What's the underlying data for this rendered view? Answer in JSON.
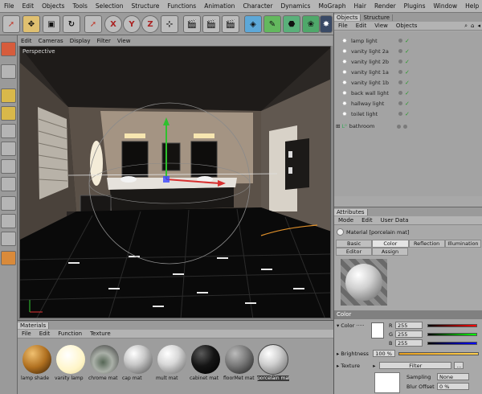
{
  "menubar": [
    "File",
    "Edit",
    "Objects",
    "Tools",
    "Selection",
    "Structure",
    "Functions",
    "Animation",
    "Character",
    "Dynamics",
    "MoGraph",
    "Hair",
    "Render",
    "Plugins",
    "Window",
    "Help"
  ],
  "toolbar": {
    "axis_x": "X",
    "axis_y": "Y",
    "axis_z": "Z"
  },
  "viewport": {
    "menu": [
      "Edit",
      "Cameras",
      "Display",
      "Filter",
      "View"
    ],
    "label": "Perspective"
  },
  "objects": {
    "tabs": [
      "Objects",
      "Structure"
    ],
    "menu": [
      "File",
      "Edit",
      "View",
      "Objects"
    ],
    "items": [
      "lamp light",
      "vanity light 2a",
      "vanity light 2b",
      "vanity light 1a",
      "vanity light 1b",
      "back wall light",
      "hallway light",
      "toilet light",
      "bathroom"
    ]
  },
  "attributes": {
    "header": "Attributes",
    "menu": [
      "Mode",
      "Edit",
      "User Data"
    ],
    "material_title": "Material [porcelain mat]",
    "tabs_row1": [
      "Basic",
      "Color",
      "Reflection",
      "Illumination"
    ],
    "tabs_row2": [
      "Editor",
      "Assign"
    ],
    "section": "Color",
    "color_label": "Color",
    "r_label": "R",
    "r_value": "255",
    "g_label": "G",
    "g_value": "255",
    "b_label": "B",
    "b_value": "255",
    "brightness_label": "Brightness",
    "brightness_value": "100 %",
    "texture_label": "Texture",
    "filter_label": "Filter",
    "sampling_label": "Sampling",
    "sampling_value": "None",
    "blur_label": "Blur Offset",
    "blur_value": "0 %"
  },
  "materials": {
    "header": "Materials",
    "menu": [
      "File",
      "Edit",
      "Function",
      "Texture"
    ],
    "items": [
      "lamp shade",
      "vanity lamp",
      "chrome mat",
      "cap mat",
      "mult mat",
      "cabinet mat",
      "floorMet mat",
      "porcelain mat"
    ]
  },
  "colors": {
    "accent": "#d8b04a",
    "panel": "#a8a8a8",
    "viewport": "#2c2825",
    "selected": "#c9c9c9"
  }
}
